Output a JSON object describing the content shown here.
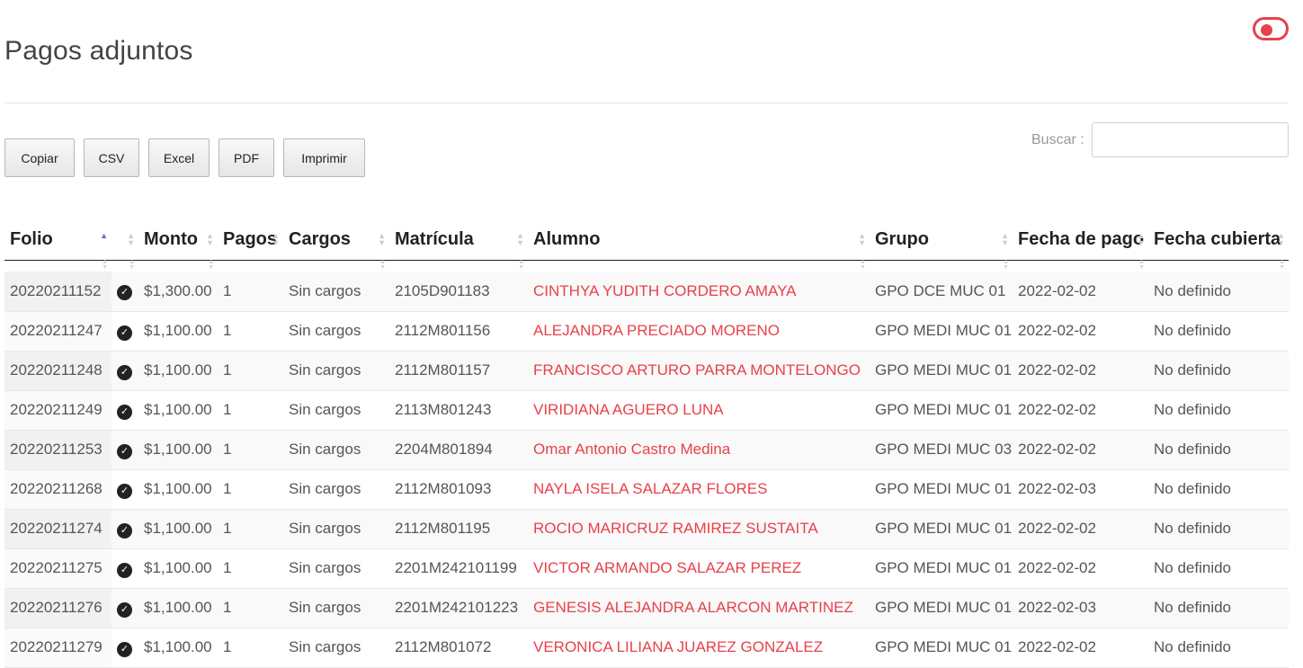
{
  "header": {
    "title": "Pagos adjuntos",
    "toggle_icon": "toggle-on-icon",
    "accent_color": "#e8414a"
  },
  "toolbar": {
    "buttons": [
      "Copiar",
      "CSV",
      "Excel",
      "PDF",
      "Imprimir"
    ],
    "search_label": "Buscar :",
    "search_value": ""
  },
  "table": {
    "columns": [
      "Folio",
      "",
      "Monto",
      "Pagos",
      "Cargos",
      "Matrícula",
      "Alumno",
      "Grupo",
      "Fecha de pago",
      "Fecha cubierta"
    ],
    "sorted_column": "Folio",
    "sort_direction": "ascending",
    "status_icon": "check-circle-icon",
    "rows": [
      {
        "folio": "20220211152",
        "monto": "$1,300.00",
        "pagos": "1",
        "cargos": "Sin cargos",
        "matricula": "2105D901183",
        "alumno": "CINTHYA YUDITH CORDERO AMAYA",
        "grupo": "GPO DCE MUC 01",
        "fecha_pago": "2022-02-02",
        "fecha_cubierta": "No definido"
      },
      {
        "folio": "20220211247",
        "monto": "$1,100.00",
        "pagos": "1",
        "cargos": "Sin cargos",
        "matricula": "2112M801156",
        "alumno": "ALEJANDRA PRECIADO MORENO",
        "grupo": "GPO MEDI MUC 01",
        "fecha_pago": "2022-02-02",
        "fecha_cubierta": "No definido"
      },
      {
        "folio": "20220211248",
        "monto": "$1,100.00",
        "pagos": "1",
        "cargos": "Sin cargos",
        "matricula": "2112M801157",
        "alumno": "FRANCISCO ARTURO PARRA MONTELONGO",
        "grupo": "GPO MEDI MUC 01",
        "fecha_pago": "2022-02-02",
        "fecha_cubierta": "No definido"
      },
      {
        "folio": "20220211249",
        "monto": "$1,100.00",
        "pagos": "1",
        "cargos": "Sin cargos",
        "matricula": "2113M801243",
        "alumno": "VIRIDIANA AGUERO LUNA",
        "grupo": "GPO MEDI MUC 01",
        "fecha_pago": "2022-02-02",
        "fecha_cubierta": "No definido"
      },
      {
        "folio": "20220211253",
        "monto": "$1,100.00",
        "pagos": "1",
        "cargos": "Sin cargos",
        "matricula": "2204M801894",
        "alumno": "Omar Antonio Castro Medina",
        "grupo": "GPO MEDI MUC 03",
        "fecha_pago": "2022-02-02",
        "fecha_cubierta": "No definido"
      },
      {
        "folio": "20220211268",
        "monto": "$1,100.00",
        "pagos": "1",
        "cargos": "Sin cargos",
        "matricula": "2112M801093",
        "alumno": "NAYLA ISELA SALAZAR FLORES",
        "grupo": "GPO MEDI MUC 01",
        "fecha_pago": "2022-02-03",
        "fecha_cubierta": "No definido"
      },
      {
        "folio": "20220211274",
        "monto": "$1,100.00",
        "pagos": "1",
        "cargos": "Sin cargos",
        "matricula": "2112M801195",
        "alumno": "ROCIO MARICRUZ RAMIREZ SUSTAITA",
        "grupo": "GPO MEDI MUC 01",
        "fecha_pago": "2022-02-02",
        "fecha_cubierta": "No definido"
      },
      {
        "folio": "20220211275",
        "monto": "$1,100.00",
        "pagos": "1",
        "cargos": "Sin cargos",
        "matricula": "2201M242101199",
        "alumno": "VICTOR ARMANDO SALAZAR PEREZ",
        "grupo": "GPO MEDI MUC 01",
        "fecha_pago": "2022-02-02",
        "fecha_cubierta": "No definido"
      },
      {
        "folio": "20220211276",
        "monto": "$1,100.00",
        "pagos": "1",
        "cargos": "Sin cargos",
        "matricula": "2201M242101223",
        "alumno": "GENESIS ALEJANDRA ALARCON MARTINEZ",
        "grupo": "GPO MEDI MUC 01",
        "fecha_pago": "2022-02-03",
        "fecha_cubierta": "No definido"
      },
      {
        "folio": "20220211279",
        "monto": "$1,100.00",
        "pagos": "1",
        "cargos": "Sin cargos",
        "matricula": "2112M801072",
        "alumno": "VERONICA LILIANA JUAREZ GONZALEZ",
        "grupo": "GPO MEDI MUC 01",
        "fecha_pago": "2022-02-02",
        "fecha_cubierta": "No definido"
      }
    ]
  }
}
